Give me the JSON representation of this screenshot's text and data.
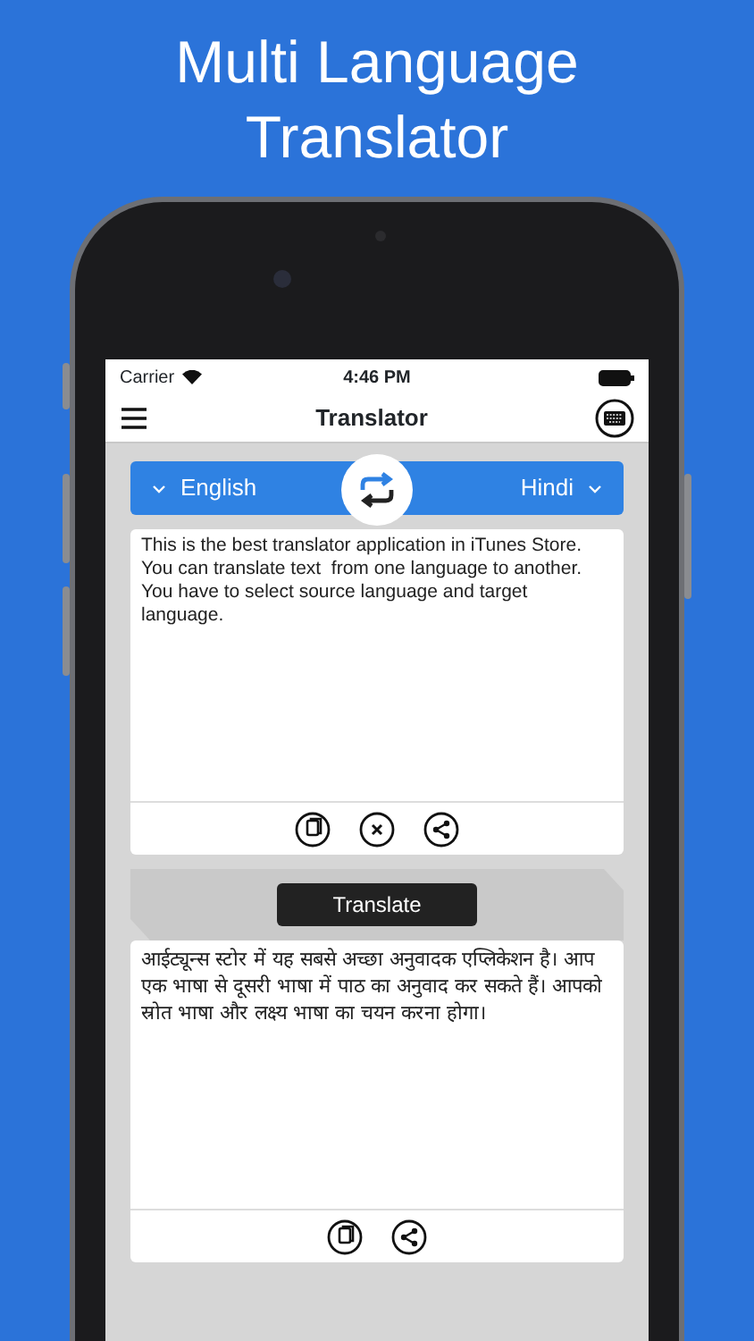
{
  "headline": "Multi Language Translator",
  "status_bar": {
    "carrier": "Carrier",
    "time": "4:46 PM"
  },
  "nav": {
    "title": "Translator"
  },
  "languages": {
    "source": "English",
    "target": "Hindi"
  },
  "source": {
    "text": "This is the best translator application in iTunes Store.\nYou can translate text  from one language to another.\nYou have to select source language and target\nlanguage.",
    "actions": [
      {
        "kind": "copy"
      },
      {
        "kind": "clear"
      },
      {
        "kind": "share"
      }
    ]
  },
  "translate_button": "Translate",
  "target": {
    "text": "आईट्यून्स स्टोर में यह सबसे अच्छा अनुवादक एप्लिकेशन है। आप एक भाषा से दूसरी भाषा में पाठ का अनुवाद कर सकते हैं। आपको स्रोत भाषा और लक्ष्य भाषा का चयन करना होगा।",
    "actions": [
      {
        "kind": "copy"
      },
      {
        "kind": "share"
      }
    ]
  }
}
